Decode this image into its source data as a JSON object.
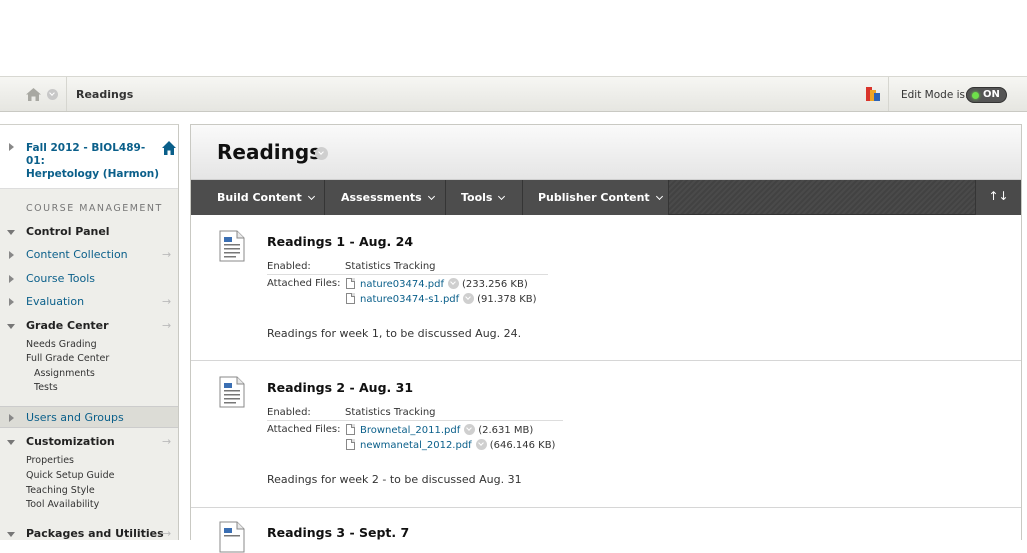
{
  "breadcrumb": {
    "current": "Readings"
  },
  "edit_mode": {
    "label": "Edit Mode is:",
    "state": "ON"
  },
  "sidebar": {
    "course_title_line1": "Fall 2012 - BIOL489-01:",
    "course_title_line2": "Herpetology (Harmon)",
    "heading": "COURSE MANAGEMENT",
    "control_panel": "Control Panel",
    "content_collection": "Content Collection",
    "course_tools": "Course Tools",
    "evaluation": "Evaluation",
    "grade_center": "Grade Center",
    "grade_center_items": [
      "Needs Grading",
      "Full Grade Center",
      "Assignments",
      "Tests"
    ],
    "users_and_groups": "Users and Groups",
    "customization": "Customization",
    "customization_items": [
      "Properties",
      "Quick Setup Guide",
      "Teaching Style",
      "Tool Availability"
    ],
    "packages_and_utilities": "Packages and Utilities",
    "go_arrow": "→"
  },
  "main": {
    "title": "Readings",
    "actions": [
      "Build Content",
      "Assessments",
      "Tools",
      "Publisher Content"
    ],
    "sort_icon": "↑↓",
    "items": [
      {
        "title": "Readings 1 - Aug. 24",
        "enabled_label": "Enabled:",
        "enabled_value": "Statistics Tracking",
        "attached_label": "Attached Files:",
        "files": [
          {
            "name": "nature03474.pdf",
            "size": "(233.256 KB)"
          },
          {
            "name": "nature03474-s1.pdf",
            "size": "(91.378 KB)"
          }
        ],
        "description": "Readings for week 1, to be discussed Aug. 24."
      },
      {
        "title": "Readings 2 - Aug. 31",
        "enabled_label": "Enabled:",
        "enabled_value": "Statistics Tracking",
        "attached_label": "Attached Files:",
        "files": [
          {
            "name": "Brownetal_2011.pdf",
            "size": "(2.631 MB)"
          },
          {
            "name": "newmanetal_2012.pdf",
            "size": "(646.146 KB)"
          }
        ],
        "description": "Readings for week 2 - to be discussed Aug. 31"
      },
      {
        "title": "Readings 3 - Sept. 7"
      }
    ]
  }
}
